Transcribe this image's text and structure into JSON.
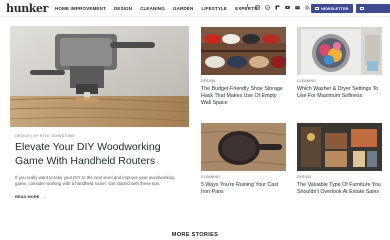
{
  "header": {
    "logo": "hunker",
    "nav": [
      "HOME IMPROVEMENT",
      "DESIGN",
      "CLEANING",
      "GARDEN",
      "LIFESTYLE",
      "EXPERTS"
    ],
    "social_icons": [
      "facebook-icon",
      "instagram-icon",
      "pinterest-icon",
      "flipboard-icon",
      "youtube-icon",
      "email-icon",
      "rss-icon",
      "search-icon"
    ],
    "newsletter_label": "NEWSLETTER",
    "advertise_label": "ADVERTISE"
  },
  "hero": {
    "kicker": "DESIGN  |  BY KYLE JOHNSTONE",
    "title": "Elevate Your DIY Woodworking Game With Handheld Routers",
    "description": "If you really want to take your DIY to the next level and improve your woodworking game, consider working with a handheld router. Get started with these tips.",
    "read_more": "READ MORE"
  },
  "cards": [
    {
      "category": "DESIGN",
      "title": "The Budget-Friendly Shoe Storage Hack That Makes Use Of Empty Wall Space"
    },
    {
      "category": "CLEANING",
      "title": "Which Washer & Dryer Settings To Use For Maximum Softness"
    },
    {
      "category": "CLEANING",
      "title": "5 Ways You're Ruining Your Cast Iron Pans"
    },
    {
      "category": "DESIGN",
      "title": "The Valuable Type Of Furniture You Shouldn't Overlook At Estate Sales"
    }
  ],
  "more_stories": "MORE STORIES"
}
